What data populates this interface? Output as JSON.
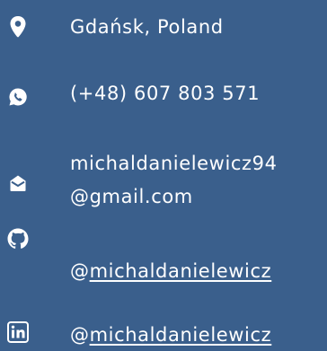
{
  "contacts": {
    "location": {
      "icon": "map-pin-icon",
      "text": "Gdańsk, Poland"
    },
    "phone": {
      "icon": "whatsapp-icon",
      "text": "(+48) 607 803 571"
    },
    "email": {
      "icon": "envelope-icon",
      "line1": "michaldanielewicz94",
      "line2": "@gmail.com"
    },
    "github": {
      "icon": "github-icon",
      "at": "@",
      "handle": "michaldanielewicz"
    },
    "linkedin": {
      "icon": "linkedin-icon",
      "at": "@",
      "handle": "michaldanielewicz"
    }
  },
  "colors": {
    "background": "#3a5f8c",
    "foreground": "#ffffff"
  }
}
